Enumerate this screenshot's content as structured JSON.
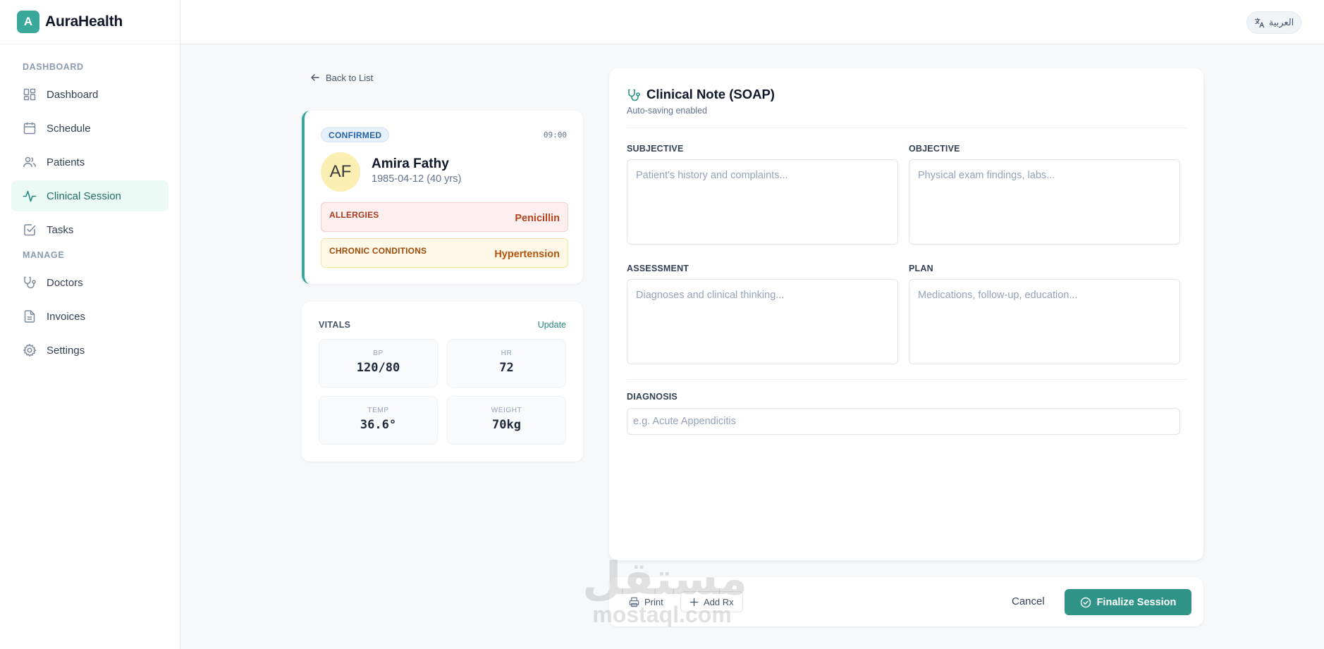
{
  "app": {
    "logo_letter": "A",
    "name": "AuraHealth"
  },
  "topbar": {
    "language_label": "العربية",
    "language_icon": "translate-icon"
  },
  "sidebar": {
    "section_dashboard": "DASHBOARD",
    "section_manage": "MANAGE",
    "items": [
      {
        "label": "Dashboard",
        "icon": "grid-icon",
        "active": false
      },
      {
        "label": "Schedule",
        "icon": "calendar-icon",
        "active": false
      },
      {
        "label": "Patients",
        "icon": "users-icon",
        "active": false
      },
      {
        "label": "Clinical Session",
        "icon": "activity-icon",
        "active": true
      },
      {
        "label": "Tasks",
        "icon": "checkbox-icon",
        "active": false
      },
      {
        "label": "Doctors",
        "icon": "stethoscope-icon",
        "active": false
      },
      {
        "label": "Invoices",
        "icon": "document-icon",
        "active": false
      },
      {
        "label": "Settings",
        "icon": "gear-icon",
        "active": false
      }
    ]
  },
  "back_link": "Back to List",
  "patient": {
    "status": "CONFIRMED",
    "time": "09:00",
    "initials": "AF",
    "name": "Amira Fathy",
    "dob": "1985-04-12 (40 yrs)",
    "allergies_label": "ALLERGIES",
    "allergies_value": "Penicillin",
    "chronic_label": "CHRONIC CONDITIONS",
    "chronic_value": "Hypertension"
  },
  "vitals": {
    "title": "VITALS",
    "update_label": "Update",
    "bp_label": "BP",
    "bp_value": "120/80",
    "hr_label": "HR",
    "hr_value": "72",
    "temp_label": "TEMP",
    "temp_value": "36.6°",
    "weight_label": "WEIGHT",
    "weight_value": "70kg"
  },
  "soap": {
    "title": "Clinical Note (SOAP)",
    "subtitle": "Auto-saving enabled",
    "subjective_label": "SUBJECTIVE",
    "subjective_placeholder": "Patient's history and complaints...",
    "objective_label": "OBJECTIVE",
    "objective_placeholder": "Physical exam findings, labs...",
    "assessment_label": "ASSESSMENT",
    "assessment_placeholder": "Diagnoses and clinical thinking...",
    "plan_label": "PLAN",
    "plan_placeholder": "Medications, follow-up, education...",
    "diagnosis_label": "DIAGNOSIS",
    "diagnosis_placeholder": "e.g. Acute Appendicitis"
  },
  "actions": {
    "print_label": "Print",
    "add_rx_label": "Add Rx",
    "cancel_label": "Cancel",
    "finalize_label": "Finalize Session"
  },
  "watermark": {
    "arabic": "مستقل",
    "latin": "mostaql.com"
  },
  "colors": {
    "brand": "#3aa99b",
    "primary_button": "#2f9487",
    "active_nav_bg": "#ecfaf6",
    "allergy_bg": "#fdeff0",
    "chronic_bg": "#fef8e6"
  }
}
